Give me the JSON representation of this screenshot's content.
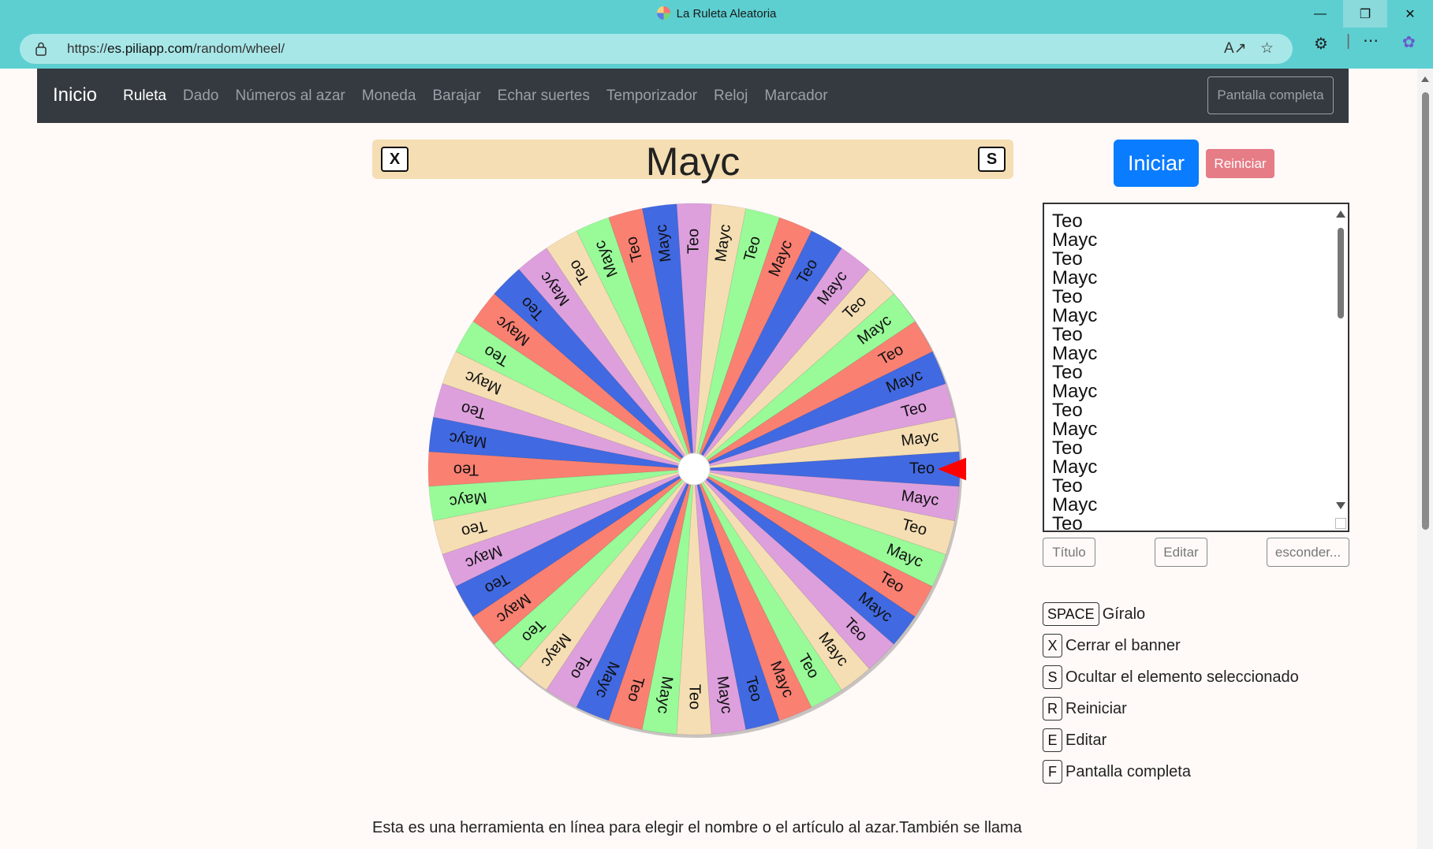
{
  "window": {
    "title": "La Ruleta Aleatoria"
  },
  "address": {
    "url_prefix": "https://",
    "url_host": "es.piliapp.com",
    "url_path": "/random/wheel/"
  },
  "navbar": {
    "brand": "Inicio",
    "items": [
      "Ruleta",
      "Dado",
      "Números al azar",
      "Moneda",
      "Barajar",
      "Echar suertes",
      "Temporizador",
      "Reloj",
      "Marcador"
    ],
    "active": "Ruleta",
    "fullscreen_label": "Pantalla completa"
  },
  "banner": {
    "close_key": "X",
    "hide_key": "S",
    "result": "Mayc"
  },
  "wheel": {
    "segment_count": 48,
    "labels": [
      "Teo",
      "Mayc"
    ],
    "colors": [
      "#4169e1",
      "#fa8072",
      "#98fb98",
      "#f5deb3",
      "#dda0dd"
    ],
    "pointer_color": "#ff0000"
  },
  "controls": {
    "start_label": "Iniciar",
    "reset_label": "Reiniciar"
  },
  "list": {
    "items": [
      "Teo",
      "Mayc",
      "Teo",
      "Mayc",
      "Teo",
      "Mayc",
      "Teo",
      "Mayc",
      "Teo",
      "Mayc",
      "Teo",
      "Mayc",
      "Teo",
      "Mayc",
      "Teo",
      "Mayc",
      "Teo"
    ]
  },
  "list_buttons": {
    "title": "Título",
    "edit": "Editar",
    "hide": "esconder..."
  },
  "shortcuts": [
    {
      "key": "SPACE",
      "desc": "Gíralo"
    },
    {
      "key": "X",
      "desc": "Cerrar el banner"
    },
    {
      "key": "S",
      "desc": "Ocultar el elemento seleccionado"
    },
    {
      "key": "R",
      "desc": "Reiniciar"
    },
    {
      "key": "E",
      "desc": "Editar"
    },
    {
      "key": "F",
      "desc": "Pantalla completa"
    }
  ],
  "description": "Esta es una herramienta en línea para elegir el nombre o el artículo al azar.También se llama"
}
